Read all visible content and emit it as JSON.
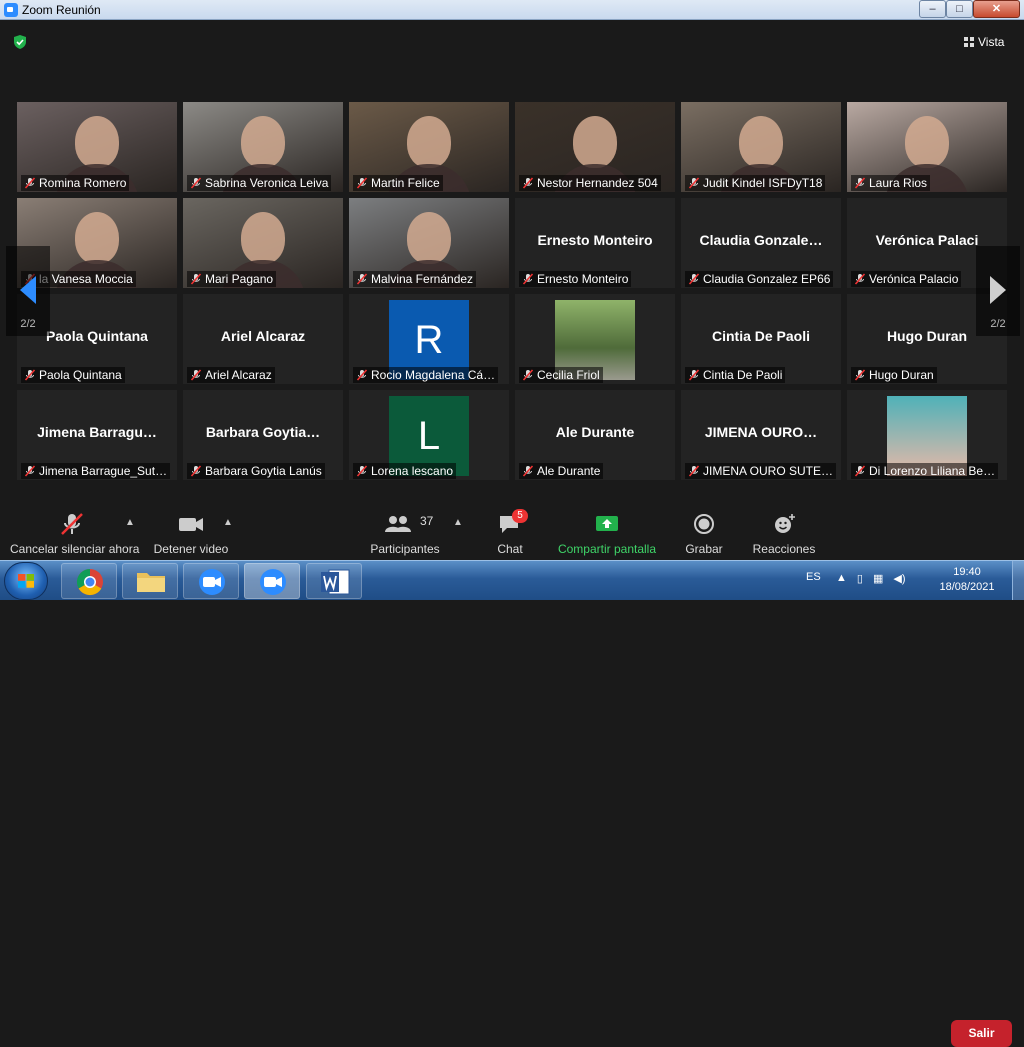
{
  "window": {
    "title": "Zoom Reunión",
    "controls": [
      "–",
      "□",
      "✕"
    ]
  },
  "topbar": {
    "view_label": "Vista"
  },
  "nav": {
    "page_indicator": "2/2"
  },
  "tiles": [
    {
      "name": "Romina Romero",
      "video": true,
      "bg": "#6b6060"
    },
    {
      "name": "Sabrina Veronica Leiva",
      "video": true,
      "bg": "#8c8a86"
    },
    {
      "name": "Martin Felice",
      "video": true,
      "bg": "#6b5a48"
    },
    {
      "name": "Nestor Hernandez 504",
      "video": true,
      "bg": "#3a3129"
    },
    {
      "name": "Judit Kindel ISFDyT18",
      "video": true,
      "bg": "#7a6e62"
    },
    {
      "name": "Laura Rios",
      "video": true,
      "bg": "#b9a9a2"
    },
    {
      "name": "la Vanesa Moccia",
      "video": true,
      "bg": "#8a7e75"
    },
    {
      "name": "Mari Pagano",
      "video": true,
      "bg": "#6a6660"
    },
    {
      "name": "Malvina Fernández",
      "video": true,
      "bg": "#7c7e80",
      "active": true
    },
    {
      "name": "Ernesto Monteiro",
      "display": "Ernesto Monteiro",
      "video": false
    },
    {
      "name": "Claudia Gonzalez EP66",
      "display": "Claudia  Gonzale…",
      "video": false
    },
    {
      "name": "Verónica Palacio",
      "display": "Verónica  Palaci",
      "video": false
    },
    {
      "name": "Paola Quintana",
      "display": "Paola Quintana",
      "video": false
    },
    {
      "name": "Ariel Alcaraz",
      "display": "Ariel Alcaraz",
      "video": false
    },
    {
      "name": "Rocio Magdalena Cá…",
      "video": false,
      "avatar": "R",
      "avatar_color": "#0a5ab0"
    },
    {
      "name": "Cecilia Friol",
      "video": false,
      "photo": true
    },
    {
      "name": "Cintia De Paoli",
      "display": "Cintia De Paoli",
      "video": false
    },
    {
      "name": "Hugo Duran",
      "display": "Hugo Duran",
      "video": false
    },
    {
      "name": "Jimena Barrague_Sut…",
      "display": "Jimena  Barragu…",
      "video": false
    },
    {
      "name": "Barbara Goytia Lanús",
      "display": "Barbara  Goytia…",
      "video": false
    },
    {
      "name": "Lorena lescano",
      "video": false,
      "avatar": "L",
      "avatar_color": "#0b5a3a"
    },
    {
      "name": "Ale Durante",
      "display": "Ale Durante",
      "video": false
    },
    {
      "name": "JIMENA OURO SUTE…",
      "display": "JIMENA  OURO…",
      "video": false
    },
    {
      "name": "Di Lorenzo Liliana Be…",
      "video": false,
      "photo": true,
      "photo_bg": "#4fb1b8"
    }
  ],
  "toolbar": {
    "mute_label": "Cancelar silenciar ahora",
    "video_label": "Detener video",
    "participants_count": "37",
    "participants_label": "Participantes",
    "chat_label": "Chat",
    "chat_badge": "5",
    "share_label": "Compartir pantalla",
    "record_label": "Grabar",
    "reactions_label": "Reacciones",
    "leave_label": "Salir",
    "share_color": "#3fd468",
    "leave_color": "#c5222c"
  },
  "taskbar": {
    "apps": [
      "Chrome",
      "Explorador",
      "Zoom",
      "Zoom",
      "Word"
    ],
    "lang": "ES",
    "time": "19:40",
    "date": "18/08/2021"
  }
}
